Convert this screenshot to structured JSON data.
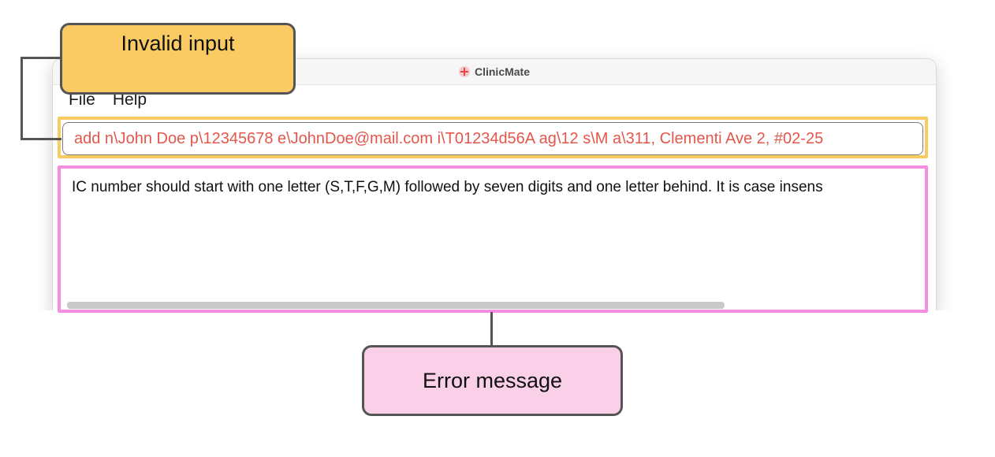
{
  "window": {
    "title": "ClinicMate",
    "icon": "clinic-cross-icon"
  },
  "menu": {
    "items": [
      "File",
      "Help"
    ]
  },
  "command_box": {
    "value": "add n\\John Doe p\\12345678 e\\JohnDoe@mail.com i\\T01234d56A ag\\12 s\\M a\\311, Clementi Ave 2, #02-25"
  },
  "result_display": {
    "message": "IC number should start with one letter (S,T,F,G,M) followed by seven digits and one letter behind. It is case insens"
  },
  "annotations": {
    "invalid_input_label": "Invalid input",
    "error_message_label": "Error message"
  },
  "colors": {
    "input_highlight": "#fbcb63",
    "error_highlight": "#f58de0",
    "error_callout_bg": "#f9d0e8",
    "command_text": "#e2574c"
  }
}
